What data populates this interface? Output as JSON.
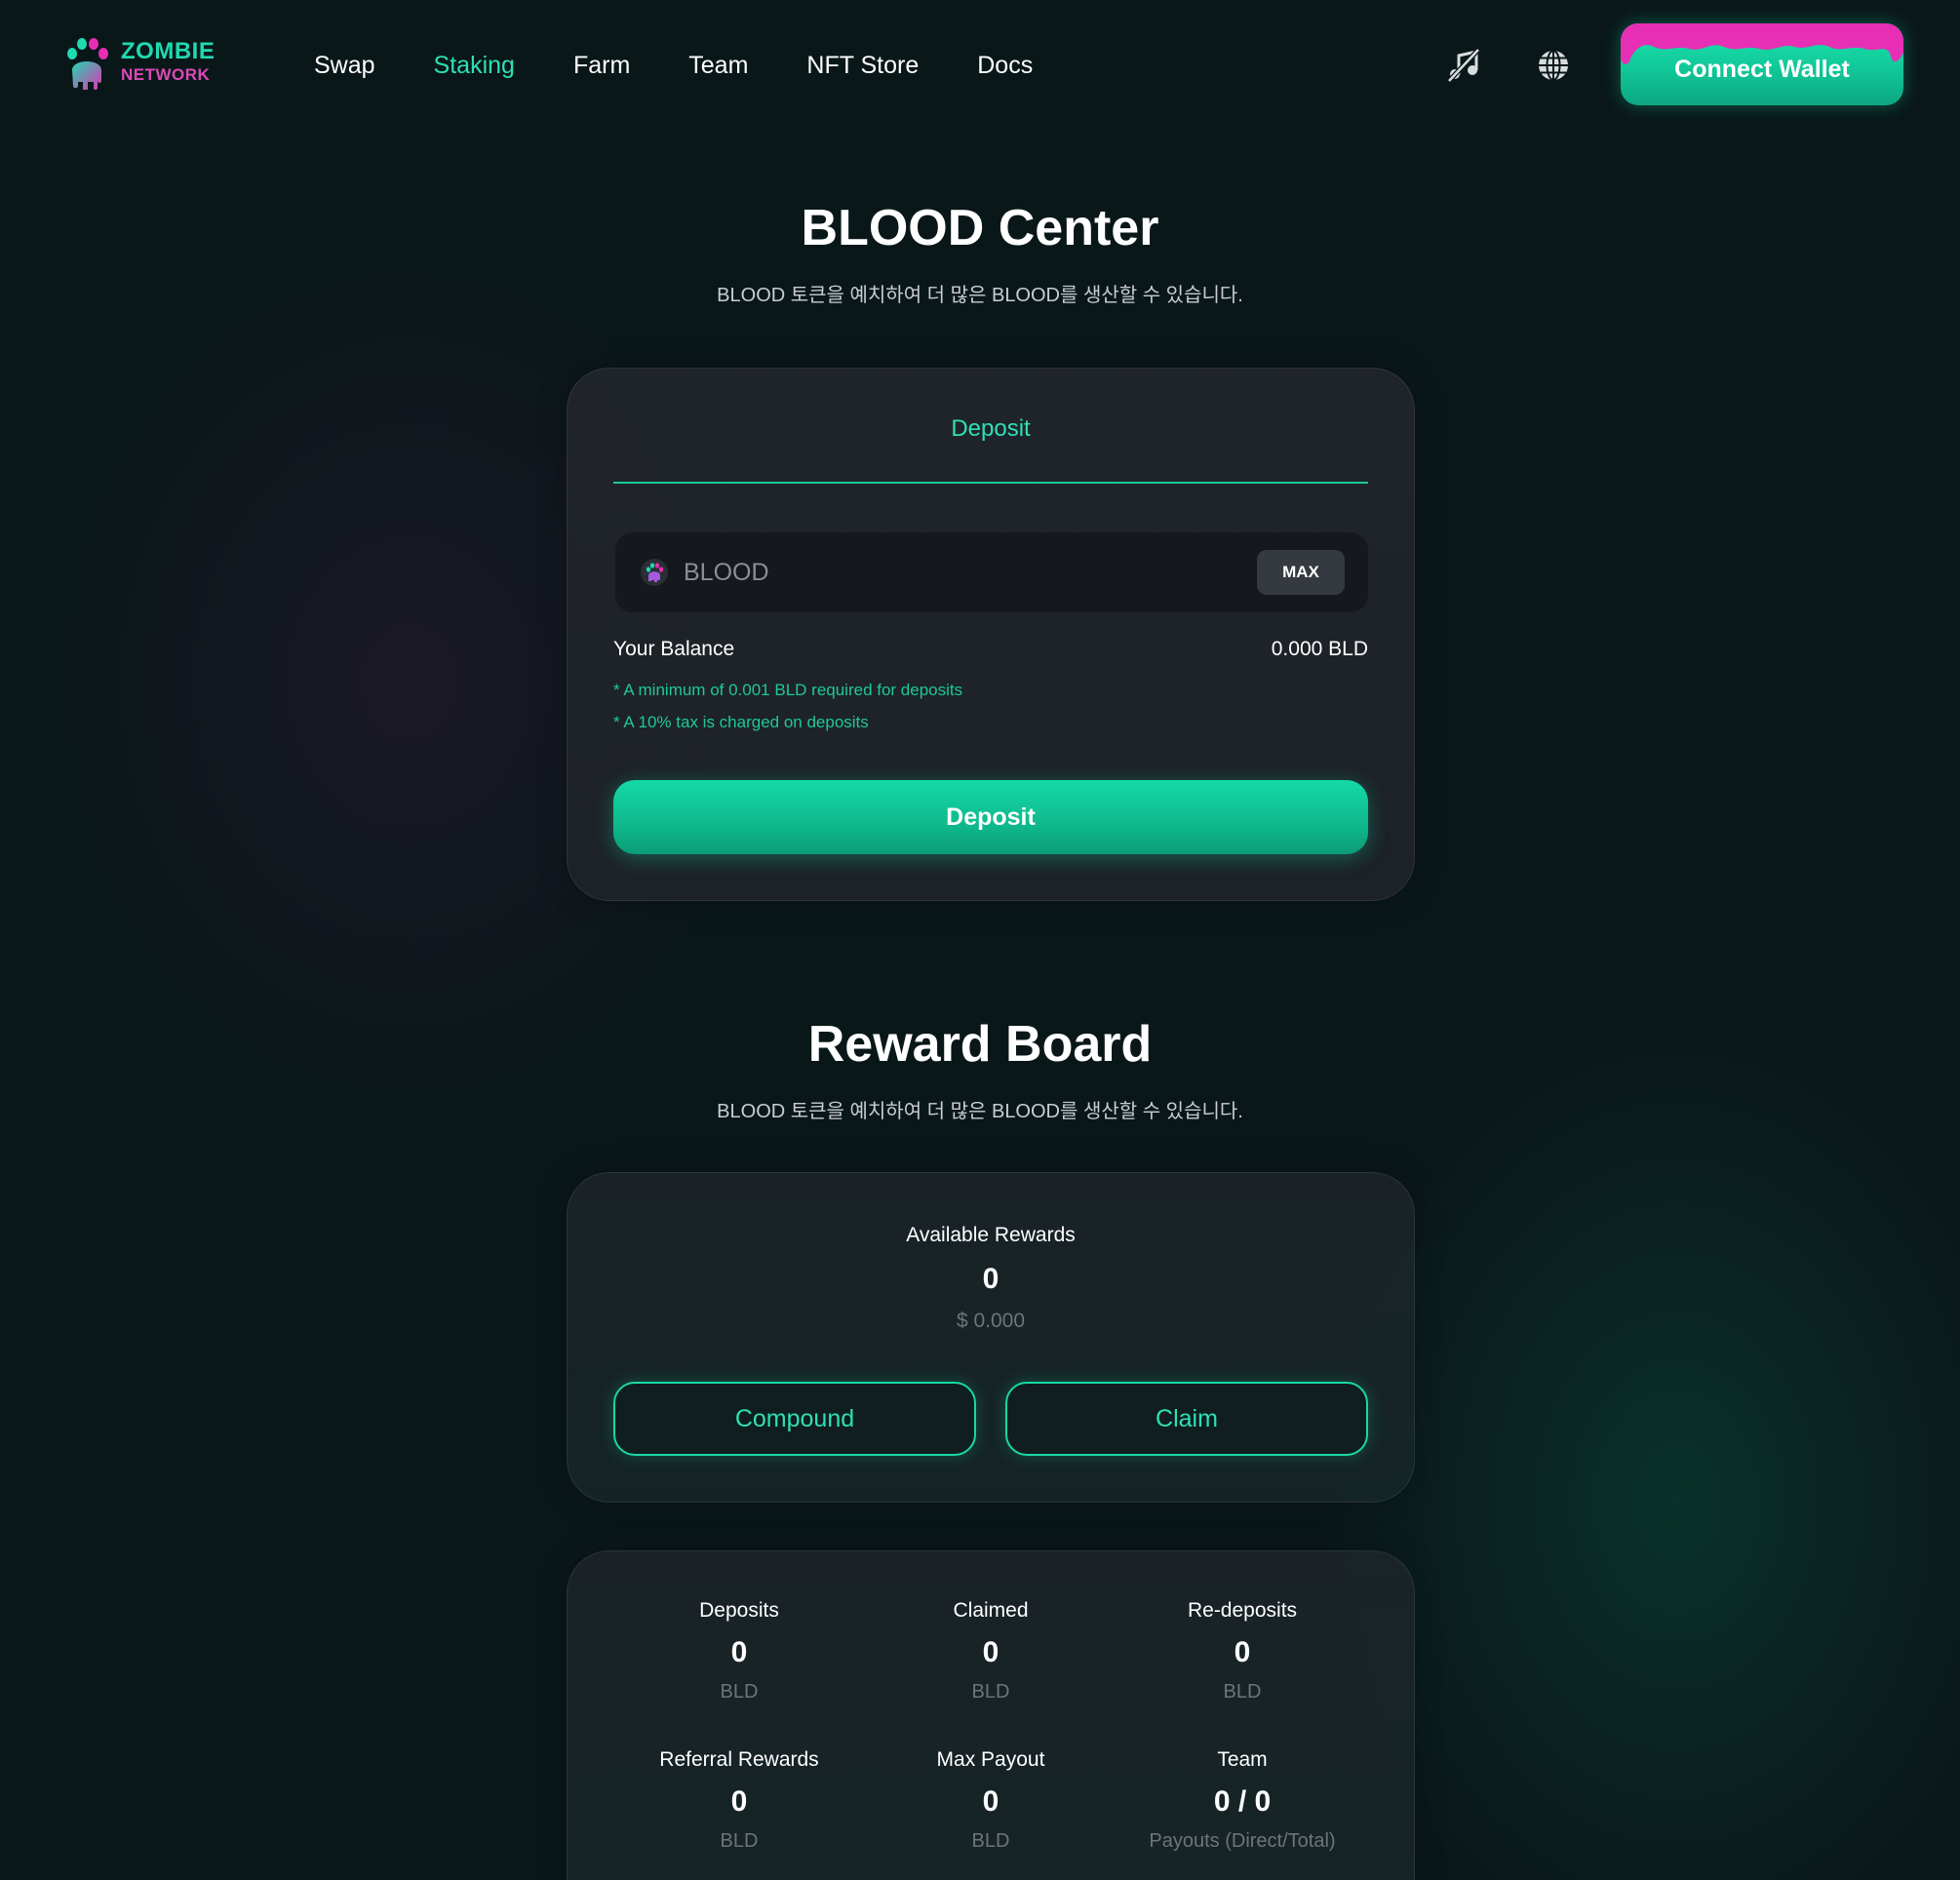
{
  "brand": {
    "name_line1": "ZOMBIE",
    "name_line2": "NETWORK"
  },
  "nav": {
    "links": [
      {
        "label": "Swap",
        "active": false
      },
      {
        "label": "Staking",
        "active": true
      },
      {
        "label": "Farm",
        "active": false
      },
      {
        "label": "Team",
        "active": false
      },
      {
        "label": "NFT Store",
        "active": false
      },
      {
        "label": "Docs",
        "active": false
      }
    ],
    "connect_label": "Connect Wallet",
    "icons": {
      "music": "music-muted-icon",
      "language": "globe-icon"
    }
  },
  "center": {
    "title": "BLOOD Center",
    "subtitle": "BLOOD 토큰을 예치하여 더 많은 BLOOD를 생산할 수 있습니다.",
    "tab_label": "Deposit",
    "input": {
      "placeholder": "BLOOD",
      "value": ""
    },
    "max_label": "MAX",
    "balance_label": "Your Balance",
    "balance_value": "0.000 BLD",
    "note_min": "* A minimum of 0.001 BLD required for deposits",
    "note_tax": "* A 10% tax is charged on deposits",
    "deposit_label": "Deposit"
  },
  "rewards": {
    "title": "Reward Board",
    "subtitle": "BLOOD 토큰을 예치하여 더 많은 BLOOD를 생산할 수 있습니다.",
    "available_label": "Available Rewards",
    "available_value": "0",
    "available_usd": "$ 0.000",
    "compound_label": "Compound",
    "claim_label": "Claim"
  },
  "stats": [
    {
      "label": "Deposits",
      "value": "0",
      "unit": "BLD"
    },
    {
      "label": "Claimed",
      "value": "0",
      "unit": "BLD"
    },
    {
      "label": "Re-deposits",
      "value": "0",
      "unit": "BLD"
    },
    {
      "label": "Referral Rewards",
      "value": "0",
      "unit": "BLD"
    },
    {
      "label": "Max Payout",
      "value": "0",
      "unit": "BLD"
    },
    {
      "label": "Team",
      "value": "0 / 0",
      "unit": "Payouts (Direct/Total)"
    }
  ],
  "colors": {
    "accent": "#2ee0b4",
    "brand_pink": "#e62fb4",
    "background": "#0a1719",
    "card": "#22262c"
  }
}
